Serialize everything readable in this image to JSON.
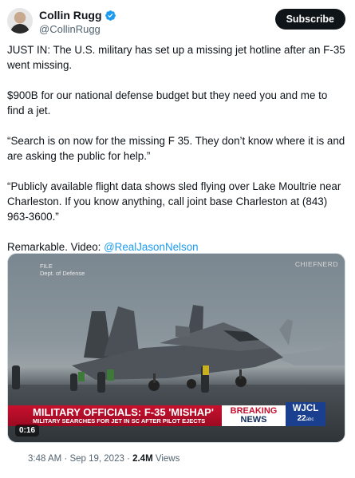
{
  "author": {
    "display_name": "Collin Rugg",
    "handle": "@CollinRugg",
    "verified": true,
    "verified_color": "#1d9bf0"
  },
  "subscribe_label": "Subscribe",
  "tweet": {
    "paragraphs": [
      "JUST IN: The U.S. military has set up a missing jet hotline after an F-35 went missing.",
      "$900B for our national defense budget but they need you and me to find a jet.",
      "“Search is on now for the missing F 35. They don’t know where it is and are asking the public for help.”",
      "“Publicly available flight data shows sled flying over Lake Moultrie near Charleston. If you know anything, call joint base Charleston at (843) 963-3600.”"
    ],
    "closing_text": "Remarkable. Video: ",
    "mention": "@RealJasonNelson"
  },
  "video": {
    "file_label_1": "FILE",
    "file_label_2": "Dept. of Defense",
    "watermark": "CHIEFNERD",
    "headline": "MILITARY OFFICIALS: F-35 'MISHAP'",
    "subheadline": "MILITARY SEARCHES FOR JET IN SC AFTER PILOT EJECTS",
    "breaking_top": "BREAKING",
    "breaking_bottom": "NEWS",
    "station": "WJCL",
    "channel": "22",
    "network": "abc",
    "duration": "0:16",
    "accent_color": "#c8102e"
  },
  "meta": {
    "time": "3:48 AM",
    "separator": " · ",
    "date": "Sep 19, 2023",
    "views_count": "2.4M",
    "views_label": " Views"
  }
}
